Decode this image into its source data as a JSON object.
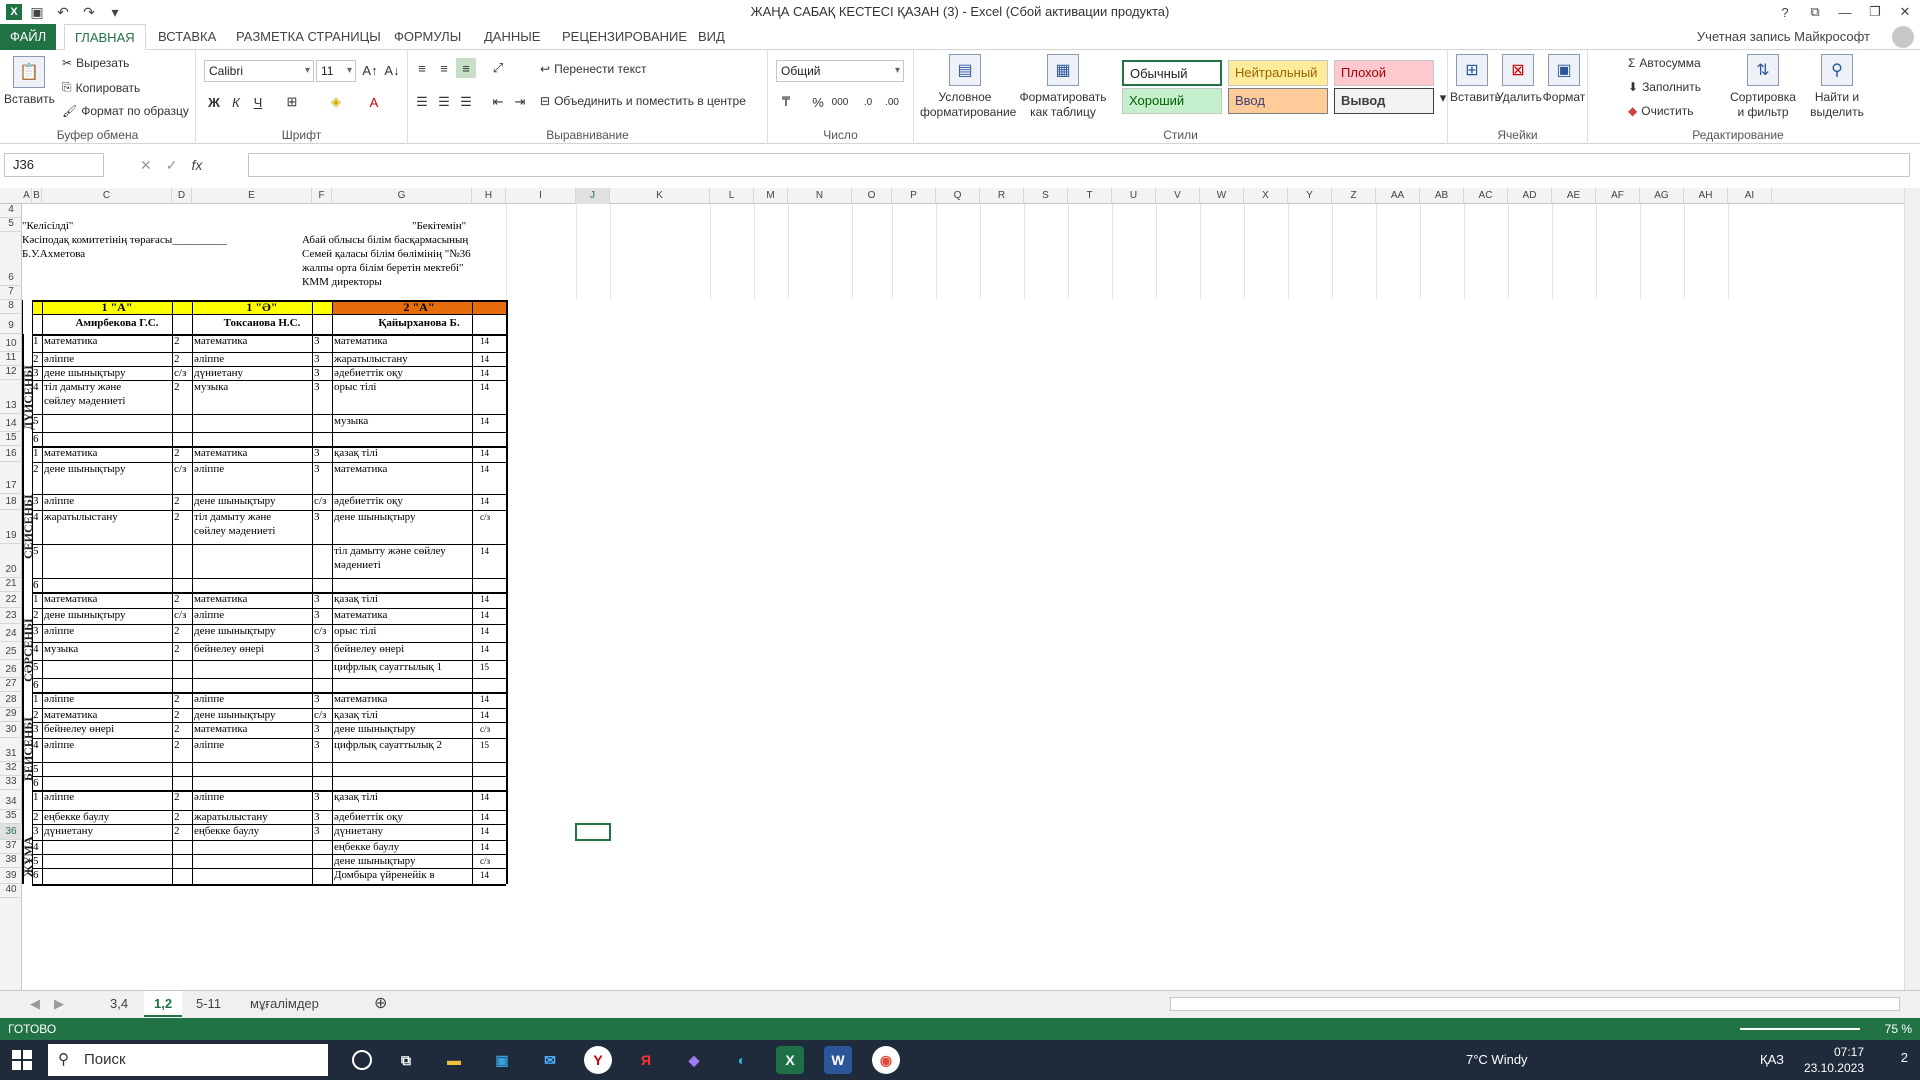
{
  "title": "ЖАҢА САБАҚ КЕСТЕСІ ҚАЗАН (3) - Excel (Сбой активации продукта)",
  "tabs": {
    "file": "ФАЙЛ",
    "home": "ГЛАВНАЯ",
    "insert": "ВСТАВКА",
    "layout": "РАЗМЕТКА СТРАНИЦЫ",
    "formulas": "ФОРМУЛЫ",
    "data": "ДАННЫЕ",
    "review": "РЕЦЕНЗИРОВАНИЕ",
    "view": "ВИД"
  },
  "account": "Учетная запись Майкрософт",
  "ribbon": {
    "paste": "Вставить",
    "cut": "Вырезать",
    "copy": "Копировать",
    "format_painter": "Формат по образцу",
    "clipboard_label": "Буфер обмена",
    "font_name": "Calibri",
    "font_size": "11",
    "font_label": "Шрифт",
    "wrap_text": "Перенести текст",
    "merge_center": "Объединить и поместить в центре",
    "alignment_label": "Выравнивание",
    "number_format": "Общий",
    "number_label": "Число",
    "cond_format_1": "Условное",
    "cond_format_2": "форматирование",
    "format_table_1": "Форматировать",
    "format_table_2": "как таблицу",
    "styles_label": "Стили",
    "style_normal": "Обычный",
    "style_neutral": "Нейтральный",
    "style_bad": "Плохой",
    "style_good": "Хороший",
    "style_input": "Ввод",
    "style_output": "Вывод",
    "insert": "Вставить",
    "delete": "Удалить",
    "format": "Формат",
    "cells_label": "Ячейки",
    "autosum": "Автосумма",
    "fill": "Заполнить",
    "clear": "Очистить",
    "sort_1": "Сортировка",
    "sort_2": "и фильтр",
    "find_1": "Найти и",
    "find_2": "выделить",
    "editing_label": "Редактирование"
  },
  "name_box": "J36",
  "columns": [
    "A",
    "B",
    "C",
    "D",
    "E",
    "F",
    "G",
    "H",
    "I",
    "J",
    "K",
    "L",
    "M",
    "N",
    "O",
    "P",
    "Q",
    "R",
    "S",
    "T",
    "U",
    "V",
    "W",
    "X",
    "Y",
    "Z",
    "AA",
    "AB",
    "AC",
    "AD",
    "AE",
    "AF",
    "AG",
    "AH",
    "AI"
  ],
  "rows": [
    "4",
    "5",
    "6",
    "7",
    "8",
    "9",
    "10",
    "11",
    "12",
    "13",
    "14",
    "15",
    "16",
    "17",
    "18",
    "19",
    "20",
    "21",
    "22",
    "23",
    "24",
    "25",
    "26",
    "27",
    "28",
    "29",
    "30",
    "31",
    "32",
    "33",
    "34",
    "35",
    "36",
    "37",
    "38",
    "39",
    "40"
  ],
  "active_row": "36",
  "header_text": {
    "agreed": "\"Келісілді\"",
    "approved": "\"Бекітемін\"",
    "committee": "Кәсіподақ комитетінің төрағасы__________",
    "committee_name": "Б.У.Ахметова",
    "dir_1": "Абай облысы білім басқармасының",
    "dir_2": "Семей қаласы  білім бөлімінің  \"№36",
    "dir_3": "жалпы орта білім беретін мектебі\"",
    "dir_4": "КММ директоры"
  },
  "classes": [
    {
      "name": "1 \"А\"",
      "teacher": "Амирбекова Г.С."
    },
    {
      "name": "1 \"Ә\"",
      "teacher": "Токсанова Н.С."
    },
    {
      "name": "2 \"А\"",
      "teacher": "Қайырханова Б."
    }
  ],
  "days": [
    "ДҮЙСЕНБІ",
    "СЕЙСЕНБІ",
    "СӘРСЕНБІ",
    "БЕЙСЕНБІ",
    "ЖҰМА"
  ],
  "schedule_rows": [
    {
      "n": "1",
      "c": "математика",
      "d": "2",
      "e": "математика",
      "f": "3",
      "g": "математика",
      "h": "14"
    },
    {
      "n": "2",
      "c": "әліппе",
      "d": "2",
      "e": "әліппе",
      "f": "3",
      "g": "жаратылыстану",
      "h": "14"
    },
    {
      "n": "3",
      "c": "дене шынықтыру",
      "d": "с/з",
      "e": "дүниетану",
      "f": "3",
      "g": "әдебиеттік оқу",
      "h": "14"
    },
    {
      "n": "4",
      "c": "тіл дамыту және",
      "c2": "сөйлеу мәдениеті",
      "d": "2",
      "e": "музыка",
      "f": "3",
      "g": "орыс тілі",
      "h": "14"
    },
    {
      "n": "5",
      "c": "",
      "d": "",
      "e": "",
      "f": "",
      "g": "музыка",
      "h": "14"
    },
    {
      "n": "6",
      "c": "",
      "d": "",
      "e": "",
      "f": "",
      "g": "",
      "h": ""
    },
    {
      "n": "1",
      "c": "математика",
      "d": "2",
      "e": "математика",
      "f": "3",
      "g": "қазақ тілі",
      "h": "14"
    },
    {
      "n": "2",
      "c": "дене шынықтыру",
      "d": "с/з",
      "e": "әліппе",
      "f": "3",
      "g": "математика",
      "h": "14"
    },
    {
      "n": "3",
      "c": "әліппе",
      "d": "2",
      "e": "дене шынықтыру",
      "f": "с/з",
      "g": "әдебиеттік оқу",
      "h": "14"
    },
    {
      "n": "4",
      "c": "жаратылыстану",
      "d": "2",
      "e": "тіл дамыту және",
      "e2": "сөйлеу мәдениеті",
      "f": "3",
      "g": "дене шынықтыру",
      "h": "с/з"
    },
    {
      "n": "5",
      "c": "",
      "d": "",
      "e": "",
      "f": "",
      "g": "тіл дамыту және сөйлеу",
      "g2": "мәдениеті",
      "h": "14"
    },
    {
      "n": "6",
      "c": "",
      "d": "",
      "e": "",
      "f": "",
      "g": "",
      "h": ""
    },
    {
      "n": "1",
      "c": "математика",
      "d": "2",
      "e": "математика",
      "f": "3",
      "g": "қазақ тілі",
      "h": "14"
    },
    {
      "n": "2",
      "c": "дене шынықтыру",
      "d": "с/з",
      "e": "әліппе",
      "f": "3",
      "g": "математика",
      "h": "14"
    },
    {
      "n": "3",
      "c": "әліппе",
      "d": "2",
      "e": "дене шынықтыру",
      "f": "с/з",
      "g": "орыс тілі",
      "h": "14"
    },
    {
      "n": "4",
      "c": "музыка",
      "d": "2",
      "e": "бейнелеу өнері",
      "f": "3",
      "g": "бейнелеу өнері",
      "h": "14"
    },
    {
      "n": "5",
      "c": "",
      "d": "",
      "e": "",
      "f": "",
      "g": "цифрлық сауаттылық 1",
      "h": "15"
    },
    {
      "n": "6",
      "c": "",
      "d": "",
      "e": "",
      "f": "",
      "g": "",
      "h": ""
    },
    {
      "n": "1",
      "c": "әліппе",
      "d": "2",
      "e": "әліппе",
      "f": "3",
      "g": "математика",
      "h": "14"
    },
    {
      "n": "2",
      "c": "математика",
      "d": "2",
      "e": "дене шынықтыру",
      "f": "с/з",
      "g": "қазақ тілі",
      "h": "14"
    },
    {
      "n": "3",
      "c": "бейнелеу өнері",
      "d": "2",
      "e": "математика",
      "f": "3",
      "g": "дене шынықтыру",
      "h": "с/з"
    },
    {
      "n": "4",
      "c": "әліппе",
      "d": "2",
      "e": "әліппе",
      "f": "3",
      "g": "цифрлық сауаттылық 2",
      "h": "15"
    },
    {
      "n": "5",
      "c": "",
      "d": "",
      "e": "",
      "f": "",
      "g": "",
      "h": ""
    },
    {
      "n": "6",
      "c": "",
      "d": "",
      "e": "",
      "f": "",
      "g": "",
      "h": ""
    },
    {
      "n": "1",
      "c": "әліппе",
      "d": "2",
      "e": "әліппе",
      "f": "3",
      "g": "қазақ тілі",
      "h": "14"
    },
    {
      "n": "2",
      "c": "еңбекке баулу",
      "d": "2",
      "e": "жаратылыстану",
      "f": "3",
      "g": "әдебиеттік оқу",
      "h": "14"
    },
    {
      "n": "3",
      "c": "дүниетану",
      "d": "2",
      "e": "еңбекке баулу",
      "f": "3",
      "g": "дүниетану",
      "h": "14"
    },
    {
      "n": "4",
      "c": "",
      "d": "",
      "e": "",
      "f": "",
      "g": "еңбекке баулу",
      "h": "14"
    },
    {
      "n": "5",
      "c": "",
      "d": "",
      "e": "",
      "f": "",
      "g": "дене шынықтыру",
      "h": "с/з"
    },
    {
      "n": "6",
      "c": "",
      "d": "",
      "e": "",
      "f": "",
      "g": "Домбыра үйренейік в",
      "h": "14"
    }
  ],
  "sheets": [
    "3,4",
    "1,2",
    "5-11",
    "мұғалімдер"
  ],
  "active_sheet": "1,2",
  "status_ready": "ГОТОВО",
  "zoom": "75 %",
  "taskbar": {
    "search": "Поиск",
    "weather": "7°C  Windy",
    "lang": "ҚАЗ",
    "time": "07:17",
    "date": "23.10.2023",
    "notifications": "2"
  }
}
